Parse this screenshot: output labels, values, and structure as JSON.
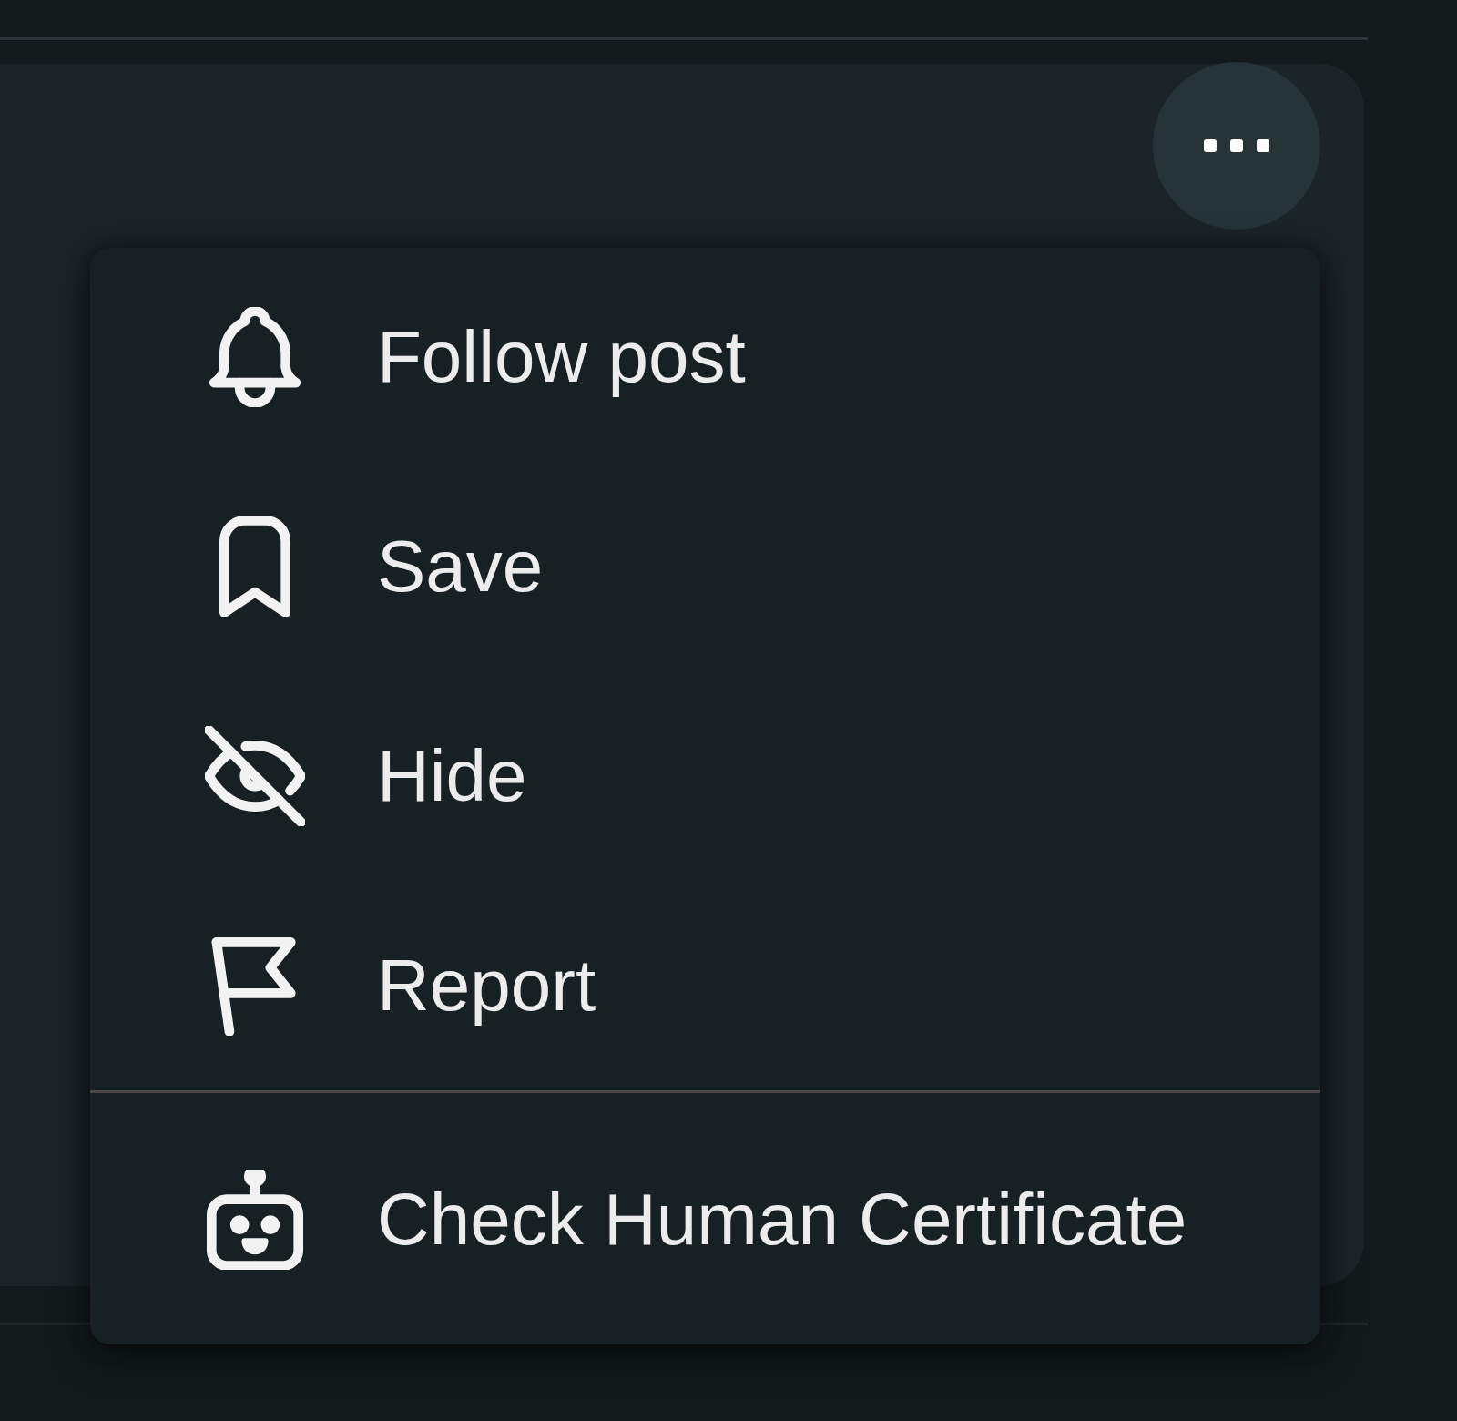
{
  "post_card": {
    "more_button": {
      "expanded": true
    }
  },
  "menu": {
    "groups": [
      {
        "items": [
          {
            "label": "Follow post"
          },
          {
            "label": "Save"
          },
          {
            "label": "Hide"
          },
          {
            "label": "Report"
          }
        ]
      },
      {
        "items": [
          {
            "label": "Check Human Certificate"
          }
        ]
      }
    ]
  }
}
